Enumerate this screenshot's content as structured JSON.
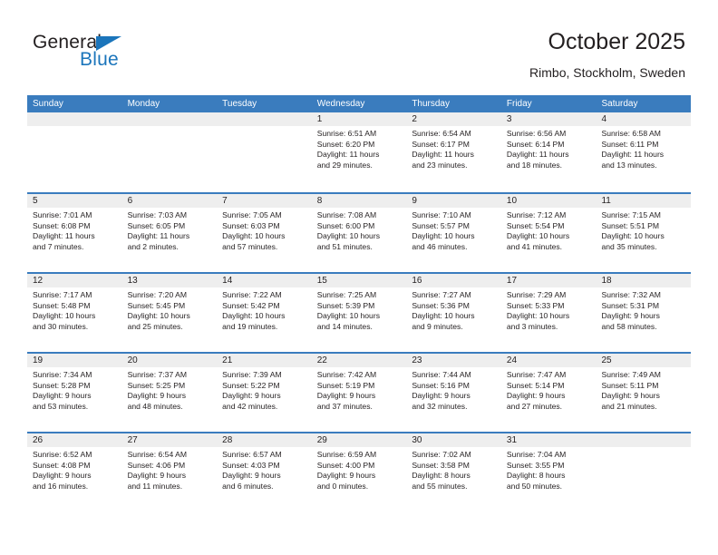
{
  "brand": {
    "name_top": "General",
    "name_bottom": "Blue",
    "triangle_color": "#1b75bb"
  },
  "header": {
    "title": "October 2025",
    "subtitle": "Rimbo, Stockholm, Sweden"
  },
  "theme": {
    "header_blue": "#3a7cbe",
    "day_band_gray": "#eeeeee",
    "text_color": "#231f20"
  },
  "weekdays": [
    "Sunday",
    "Monday",
    "Tuesday",
    "Wednesday",
    "Thursday",
    "Friday",
    "Saturday"
  ],
  "weeks": [
    [
      {
        "day": "",
        "empty": true,
        "sunrise": "",
        "sunset": "",
        "daylight1": "",
        "daylight2": ""
      },
      {
        "day": "",
        "empty": true,
        "sunrise": "",
        "sunset": "",
        "daylight1": "",
        "daylight2": ""
      },
      {
        "day": "",
        "empty": true,
        "sunrise": "",
        "sunset": "",
        "daylight1": "",
        "daylight2": ""
      },
      {
        "day": "1",
        "empty": false,
        "sunrise": "Sunrise: 6:51 AM",
        "sunset": "Sunset: 6:20 PM",
        "daylight1": "Daylight: 11 hours",
        "daylight2": "and 29 minutes."
      },
      {
        "day": "2",
        "empty": false,
        "sunrise": "Sunrise: 6:54 AM",
        "sunset": "Sunset: 6:17 PM",
        "daylight1": "Daylight: 11 hours",
        "daylight2": "and 23 minutes."
      },
      {
        "day": "3",
        "empty": false,
        "sunrise": "Sunrise: 6:56 AM",
        "sunset": "Sunset: 6:14 PM",
        "daylight1": "Daylight: 11 hours",
        "daylight2": "and 18 minutes."
      },
      {
        "day": "4",
        "empty": false,
        "sunrise": "Sunrise: 6:58 AM",
        "sunset": "Sunset: 6:11 PM",
        "daylight1": "Daylight: 11 hours",
        "daylight2": "and 13 minutes."
      }
    ],
    [
      {
        "day": "5",
        "empty": false,
        "sunrise": "Sunrise: 7:01 AM",
        "sunset": "Sunset: 6:08 PM",
        "daylight1": "Daylight: 11 hours",
        "daylight2": "and 7 minutes."
      },
      {
        "day": "6",
        "empty": false,
        "sunrise": "Sunrise: 7:03 AM",
        "sunset": "Sunset: 6:05 PM",
        "daylight1": "Daylight: 11 hours",
        "daylight2": "and 2 minutes."
      },
      {
        "day": "7",
        "empty": false,
        "sunrise": "Sunrise: 7:05 AM",
        "sunset": "Sunset: 6:03 PM",
        "daylight1": "Daylight: 10 hours",
        "daylight2": "and 57 minutes."
      },
      {
        "day": "8",
        "empty": false,
        "sunrise": "Sunrise: 7:08 AM",
        "sunset": "Sunset: 6:00 PM",
        "daylight1": "Daylight: 10 hours",
        "daylight2": "and 51 minutes."
      },
      {
        "day": "9",
        "empty": false,
        "sunrise": "Sunrise: 7:10 AM",
        "sunset": "Sunset: 5:57 PM",
        "daylight1": "Daylight: 10 hours",
        "daylight2": "and 46 minutes."
      },
      {
        "day": "10",
        "empty": false,
        "sunrise": "Sunrise: 7:12 AM",
        "sunset": "Sunset: 5:54 PM",
        "daylight1": "Daylight: 10 hours",
        "daylight2": "and 41 minutes."
      },
      {
        "day": "11",
        "empty": false,
        "sunrise": "Sunrise: 7:15 AM",
        "sunset": "Sunset: 5:51 PM",
        "daylight1": "Daylight: 10 hours",
        "daylight2": "and 35 minutes."
      }
    ],
    [
      {
        "day": "12",
        "empty": false,
        "sunrise": "Sunrise: 7:17 AM",
        "sunset": "Sunset: 5:48 PM",
        "daylight1": "Daylight: 10 hours",
        "daylight2": "and 30 minutes."
      },
      {
        "day": "13",
        "empty": false,
        "sunrise": "Sunrise: 7:20 AM",
        "sunset": "Sunset: 5:45 PM",
        "daylight1": "Daylight: 10 hours",
        "daylight2": "and 25 minutes."
      },
      {
        "day": "14",
        "empty": false,
        "sunrise": "Sunrise: 7:22 AM",
        "sunset": "Sunset: 5:42 PM",
        "daylight1": "Daylight: 10 hours",
        "daylight2": "and 19 minutes."
      },
      {
        "day": "15",
        "empty": false,
        "sunrise": "Sunrise: 7:25 AM",
        "sunset": "Sunset: 5:39 PM",
        "daylight1": "Daylight: 10 hours",
        "daylight2": "and 14 minutes."
      },
      {
        "day": "16",
        "empty": false,
        "sunrise": "Sunrise: 7:27 AM",
        "sunset": "Sunset: 5:36 PM",
        "daylight1": "Daylight: 10 hours",
        "daylight2": "and 9 minutes."
      },
      {
        "day": "17",
        "empty": false,
        "sunrise": "Sunrise: 7:29 AM",
        "sunset": "Sunset: 5:33 PM",
        "daylight1": "Daylight: 10 hours",
        "daylight2": "and 3 minutes."
      },
      {
        "day": "18",
        "empty": false,
        "sunrise": "Sunrise: 7:32 AM",
        "sunset": "Sunset: 5:31 PM",
        "daylight1": "Daylight: 9 hours",
        "daylight2": "and 58 minutes."
      }
    ],
    [
      {
        "day": "19",
        "empty": false,
        "sunrise": "Sunrise: 7:34 AM",
        "sunset": "Sunset: 5:28 PM",
        "daylight1": "Daylight: 9 hours",
        "daylight2": "and 53 minutes."
      },
      {
        "day": "20",
        "empty": false,
        "sunrise": "Sunrise: 7:37 AM",
        "sunset": "Sunset: 5:25 PM",
        "daylight1": "Daylight: 9 hours",
        "daylight2": "and 48 minutes."
      },
      {
        "day": "21",
        "empty": false,
        "sunrise": "Sunrise: 7:39 AM",
        "sunset": "Sunset: 5:22 PM",
        "daylight1": "Daylight: 9 hours",
        "daylight2": "and 42 minutes."
      },
      {
        "day": "22",
        "empty": false,
        "sunrise": "Sunrise: 7:42 AM",
        "sunset": "Sunset: 5:19 PM",
        "daylight1": "Daylight: 9 hours",
        "daylight2": "and 37 minutes."
      },
      {
        "day": "23",
        "empty": false,
        "sunrise": "Sunrise: 7:44 AM",
        "sunset": "Sunset: 5:16 PM",
        "daylight1": "Daylight: 9 hours",
        "daylight2": "and 32 minutes."
      },
      {
        "day": "24",
        "empty": false,
        "sunrise": "Sunrise: 7:47 AM",
        "sunset": "Sunset: 5:14 PM",
        "daylight1": "Daylight: 9 hours",
        "daylight2": "and 27 minutes."
      },
      {
        "day": "25",
        "empty": false,
        "sunrise": "Sunrise: 7:49 AM",
        "sunset": "Sunset: 5:11 PM",
        "daylight1": "Daylight: 9 hours",
        "daylight2": "and 21 minutes."
      }
    ],
    [
      {
        "day": "26",
        "empty": false,
        "sunrise": "Sunrise: 6:52 AM",
        "sunset": "Sunset: 4:08 PM",
        "daylight1": "Daylight: 9 hours",
        "daylight2": "and 16 minutes."
      },
      {
        "day": "27",
        "empty": false,
        "sunrise": "Sunrise: 6:54 AM",
        "sunset": "Sunset: 4:06 PM",
        "daylight1": "Daylight: 9 hours",
        "daylight2": "and 11 minutes."
      },
      {
        "day": "28",
        "empty": false,
        "sunrise": "Sunrise: 6:57 AM",
        "sunset": "Sunset: 4:03 PM",
        "daylight1": "Daylight: 9 hours",
        "daylight2": "and 6 minutes."
      },
      {
        "day": "29",
        "empty": false,
        "sunrise": "Sunrise: 6:59 AM",
        "sunset": "Sunset: 4:00 PM",
        "daylight1": "Daylight: 9 hours",
        "daylight2": "and 0 minutes."
      },
      {
        "day": "30",
        "empty": false,
        "sunrise": "Sunrise: 7:02 AM",
        "sunset": "Sunset: 3:58 PM",
        "daylight1": "Daylight: 8 hours",
        "daylight2": "and 55 minutes."
      },
      {
        "day": "31",
        "empty": false,
        "sunrise": "Sunrise: 7:04 AM",
        "sunset": "Sunset: 3:55 PM",
        "daylight1": "Daylight: 8 hours",
        "daylight2": "and 50 minutes."
      },
      {
        "day": "",
        "empty": true,
        "sunrise": "",
        "sunset": "",
        "daylight1": "",
        "daylight2": ""
      }
    ]
  ]
}
